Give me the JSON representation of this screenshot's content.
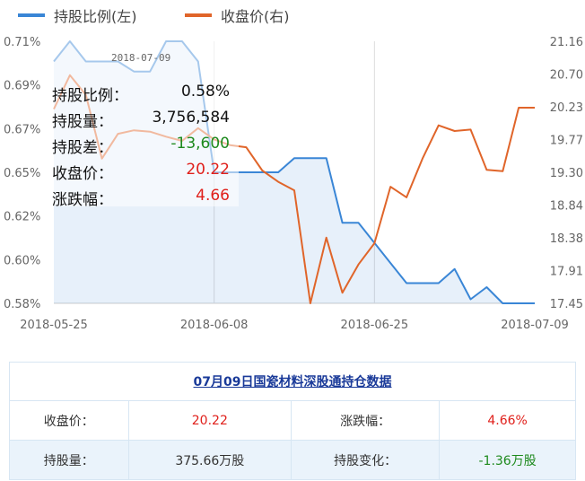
{
  "legend": {
    "left_label": "持股比例(左)",
    "right_label": "收盘价(右)",
    "left_color": "#3a86d6",
    "right_color": "#e0652a"
  },
  "chart_data": {
    "type": "line",
    "x": [
      "2018-05-25",
      "2018-05-28",
      "2018-05-29",
      "2018-05-30",
      "2018-05-31",
      "2018-06-01",
      "2018-06-04",
      "2018-06-05",
      "2018-06-06",
      "2018-06-07",
      "2018-06-08",
      "2018-06-11",
      "2018-06-12",
      "2018-06-13",
      "2018-06-14",
      "2018-06-15",
      "2018-06-19",
      "2018-06-20",
      "2018-06-21",
      "2018-06-22",
      "2018-06-25",
      "2018-06-26",
      "2018-06-27",
      "2018-06-28",
      "2018-06-29",
      "2018-07-02",
      "2018-07-03",
      "2018-07-04",
      "2018-07-05",
      "2018-07-06",
      "2018-07-09"
    ],
    "x_tick_labels": [
      "2018-05-25",
      "2018-06-08",
      "2018-06-25",
      "2018-07-09"
    ],
    "y_left_tick_labels": [
      "0.71%",
      "0.69%",
      "0.67%",
      "0.65%",
      "0.62%",
      "0.60%",
      "0.58%"
    ],
    "y_right_tick_labels": [
      "21.16",
      "20.70",
      "20.23",
      "19.77",
      "19.30",
      "18.84",
      "18.38",
      "17.91",
      "17.45"
    ],
    "ylim_left": [
      0.58,
      0.71
    ],
    "ylim_right": [
      17.45,
      21.16
    ],
    "series": [
      {
        "name": "持股比例(左)",
        "axis": "left",
        "color": "#3a86d6",
        "area": true,
        "values": [
          0.7,
          0.71,
          0.7,
          0.7,
          0.7,
          0.695,
          0.695,
          0.71,
          0.71,
          0.7,
          0.645,
          0.645,
          0.645,
          0.645,
          0.645,
          0.652,
          0.652,
          0.652,
          0.62,
          0.62,
          0.61,
          0.6,
          0.59,
          0.59,
          0.59,
          0.597,
          0.582,
          0.588,
          0.58,
          0.58,
          0.58
        ]
      },
      {
        "name": "收盘价(右)",
        "axis": "right",
        "color": "#e0652a",
        "area": false,
        "values": [
          20.2,
          20.68,
          20.4,
          19.5,
          19.85,
          19.9,
          19.88,
          19.81,
          19.75,
          19.93,
          19.77,
          19.69,
          19.66,
          19.33,
          19.17,
          19.05,
          17.45,
          18.38,
          17.6,
          18.0,
          18.3,
          19.1,
          18.95,
          19.5,
          19.97,
          19.89,
          19.91,
          19.34,
          19.32,
          20.22,
          20.22
        ]
      }
    ],
    "grid": "vertical-lines",
    "legend_position": "top-left"
  },
  "tooltip": {
    "date": "2018-07-09",
    "rows": [
      {
        "key": "持股比例：",
        "value": "0.58%",
        "tone": "normal"
      },
      {
        "key": "持股量：",
        "value": "3,756,584",
        "tone": "normal"
      },
      {
        "key": "持股差：",
        "value": "-13,600",
        "tone": "green"
      },
      {
        "key": "收盘价：",
        "value": "20.22",
        "tone": "red"
      },
      {
        "key": "涨跌幅：",
        "value": "4.66",
        "tone": "red"
      }
    ]
  },
  "table": {
    "title": "07月09日国瓷材料深股通持仓数据",
    "row1": {
      "label1": "收盘价：",
      "value1": "20.22",
      "label2": "涨跌幅：",
      "value2": "4.66%"
    },
    "row2": {
      "label1": "持股量：",
      "value1": "375.66万股",
      "label2": "持股变化：",
      "value2": "-1.36万股"
    }
  }
}
